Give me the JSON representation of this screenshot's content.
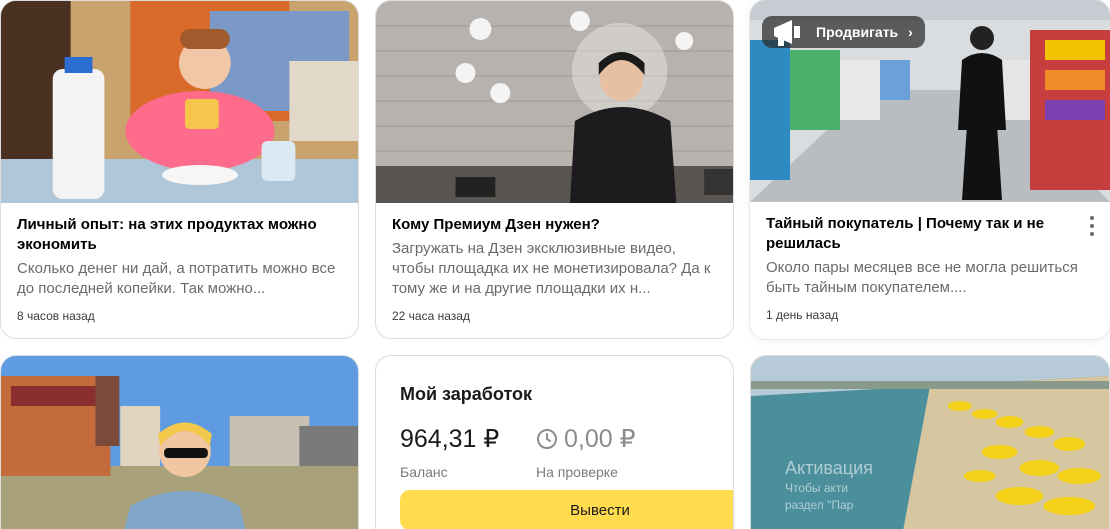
{
  "cards": [
    {
      "title": "Личный опыт: на этих продуктах можно экономить",
      "snippet": "Сколько денег ни дай, а потратить можно все до последней копейки. Так можно...",
      "time": "8 часов назад"
    },
    {
      "title": "Кому Премиум Дзен нужен?",
      "snippet": "Загружать на Дзен эксклюзивные видео, чтобы площадка их не монетизировала? Да к тому же и на другие площадки их н...",
      "time": "22 часа назад"
    },
    {
      "title": "Тайный покупатель | Почему так и не решилась",
      "snippet": "Около пары месяцев все не могла решиться быть тайным покупателем....",
      "time": "1 день назад",
      "promote_label": "Продвигать"
    }
  ],
  "earnings": {
    "title": "Мой заработок",
    "balance": "964,31 ₽",
    "balance_label": "Баланс",
    "review": "0,00 ₽",
    "review_label": "На проверке",
    "withdraw_label": "Вывести"
  },
  "overlay": {
    "activate_title": "Активация",
    "activate_text_1": "Чтобы акти",
    "activate_text_2": "раздел \"Пар"
  },
  "colors": {
    "accent": "#ffdb4d",
    "muted": "#6b6b6b"
  },
  "icons": [
    "promote-icon",
    "chevron-right-icon",
    "more-vertical-icon",
    "clock-icon"
  ]
}
